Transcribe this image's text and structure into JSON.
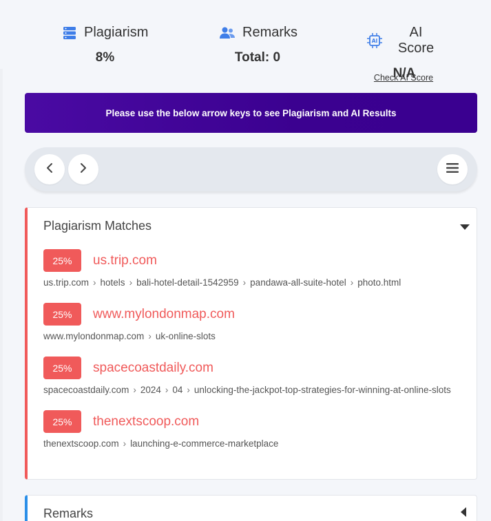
{
  "stats": {
    "plagiarism": {
      "label": "Plagiarism",
      "value": "8%"
    },
    "remarks": {
      "label": "Remarks",
      "value": "Total: 0"
    },
    "ai_score": {
      "label": "AI Score",
      "value": "N/A",
      "link": "Check AI Score"
    }
  },
  "banner": {
    "text": "Please use the below arrow keys to see Plagiarism and AI Results"
  },
  "nav": {
    "prev_icon": "chevron-left-icon",
    "next_icon": "chevron-right-icon",
    "menu_icon": "hamburger-icon"
  },
  "matches_card": {
    "title": "Plagiarism Matches",
    "items": [
      {
        "percent": "25%",
        "domain": "us.trip.com",
        "path": "us.trip.com › hotels › bali-hotel-detail-1542959 › pandawa-all-suite-hotel › photo.html"
      },
      {
        "percent": "25%",
        "domain": "www.mylondonmap.com",
        "path": "www.mylondonmap.com › uk-online-slots"
      },
      {
        "percent": "25%",
        "domain": "spacecoastdaily.com",
        "path": "spacecoastdaily.com › 2024 › 04 › unlocking-the-jackpot-top-strategies-for-winning-at-online-slots"
      },
      {
        "percent": "25%",
        "domain": "thenextscoop.com",
        "path": "thenextscoop.com › launching-e-commerce-marketplace"
      }
    ]
  },
  "remarks_card": {
    "title": "Remarks"
  },
  "colors": {
    "accent_red": "#f05a5a",
    "banner_purple": "#3b0190",
    "icon_blue": "#3f7ee8",
    "remarks_blue": "#2b8fe8"
  }
}
